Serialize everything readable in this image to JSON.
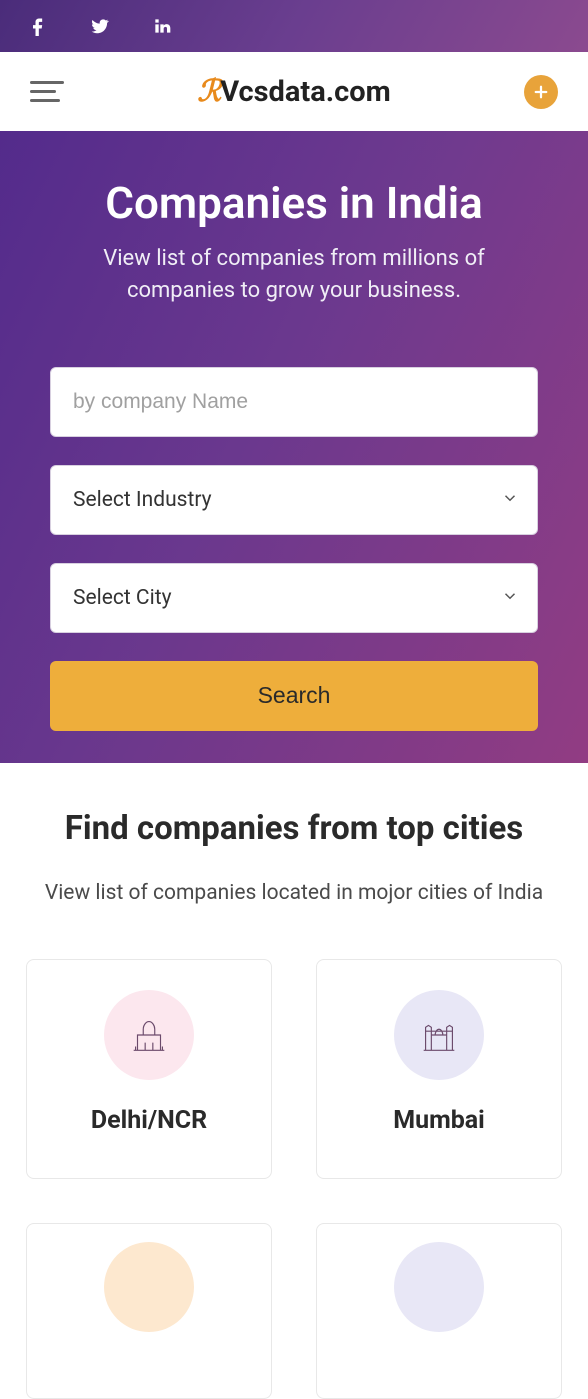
{
  "social": [
    "facebook",
    "twitter",
    "linkedin"
  ],
  "brand": {
    "name": "Vcsdata.com"
  },
  "hero": {
    "title": "Companies in India",
    "subtitle": "View list of companies from millions of companies to grow your business."
  },
  "search": {
    "name_placeholder": "by company Name",
    "industry_label": "Select Industry",
    "city_label": "Select City",
    "button": "Search"
  },
  "cities_section": {
    "title": "Find companies from top cities",
    "subtitle": "View list of companies located in mojor cities of India"
  },
  "cities": [
    {
      "name": "Delhi/NCR",
      "tint": "pink"
    },
    {
      "name": "Mumbai",
      "tint": "lav"
    }
  ]
}
